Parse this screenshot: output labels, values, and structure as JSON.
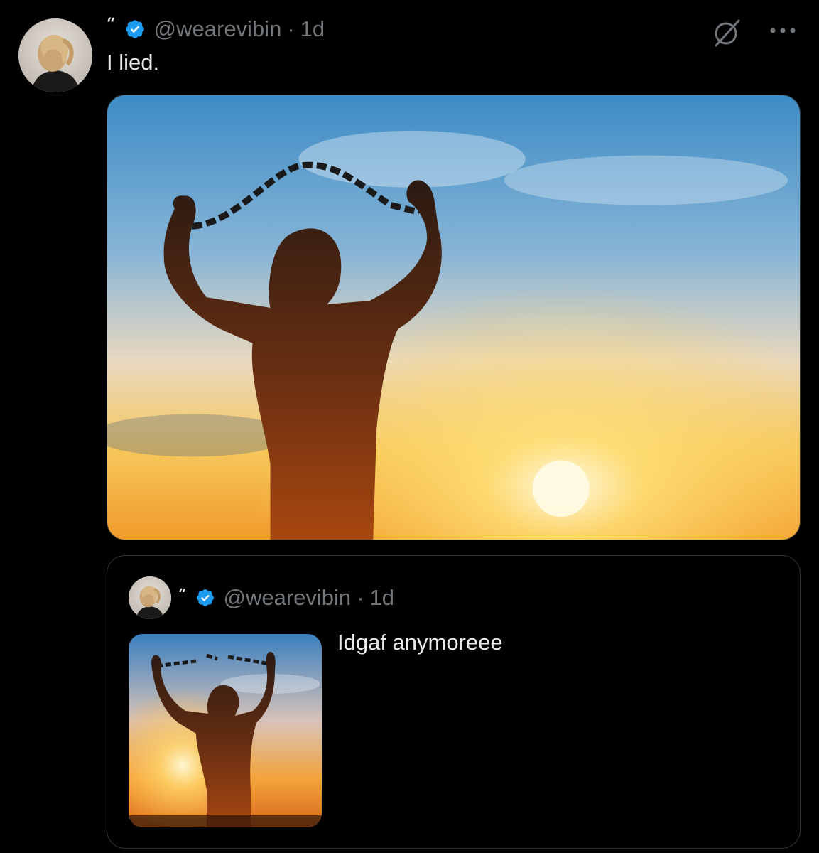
{
  "colors": {
    "background": "#000000",
    "text": "#e7e9ea",
    "muted": "#71767b",
    "verified": "#1d9bf0",
    "border": "#2f3336"
  },
  "tweet": {
    "quote_glyph": "“",
    "handle": "@wearevibin",
    "separator": "·",
    "time": "1d",
    "text": "I lied.",
    "icons": [
      "avatar",
      "verified-badge-icon",
      "grok-icon",
      "more-options-icon"
    ]
  },
  "quoted_tweet": {
    "quote_glyph": "“",
    "handle": "@wearevibin",
    "separator": "·",
    "time": "1d",
    "text": "Idgaf anymoreee"
  }
}
